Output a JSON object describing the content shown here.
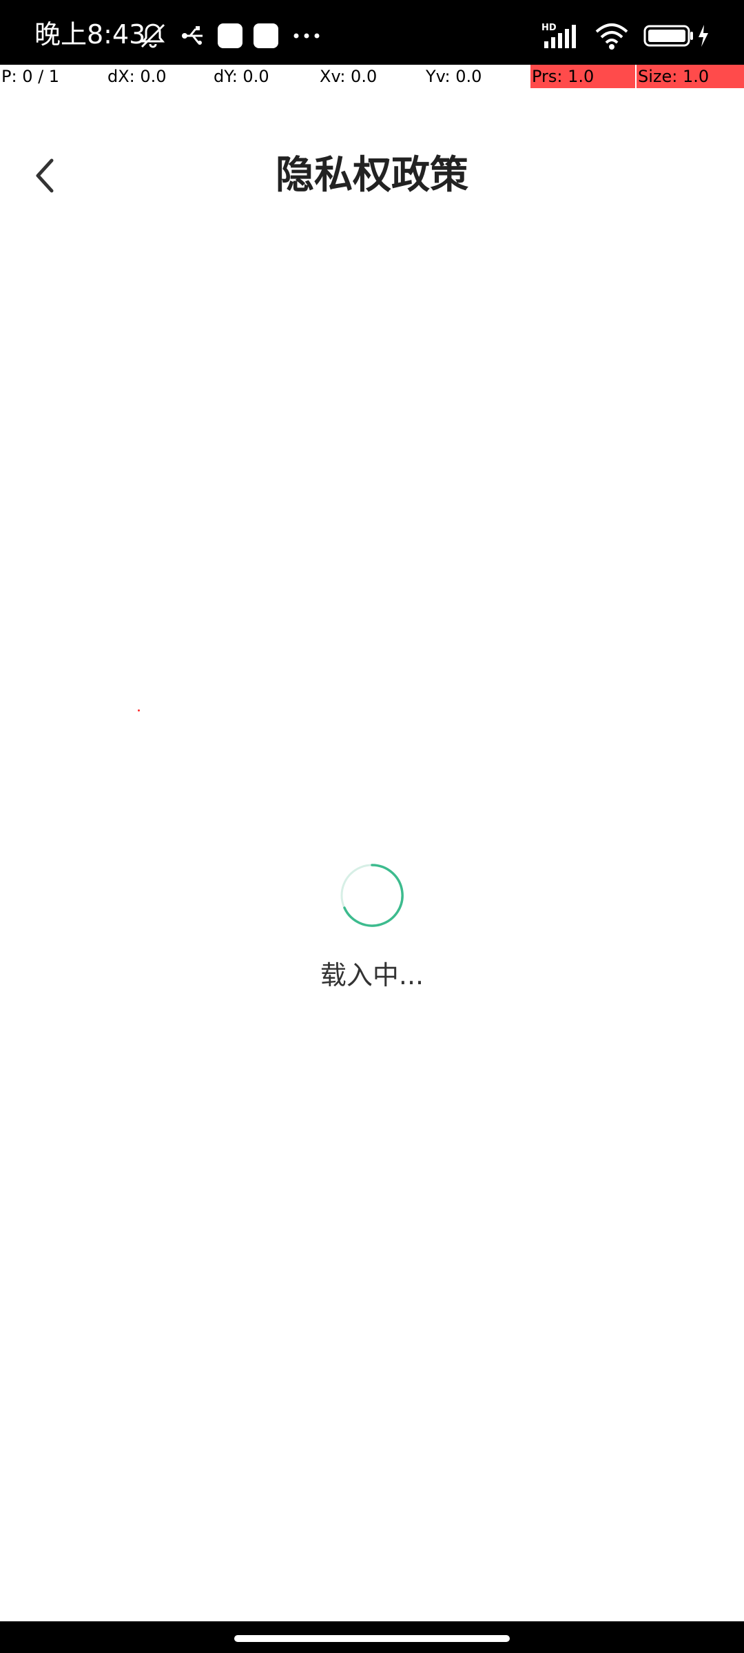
{
  "status_bar": {
    "time": "晚上8:43",
    "icons": [
      "bell-muted-icon",
      "usb-icon",
      "app-notification-icon",
      "app-notification-icon",
      "more-dots-icon",
      "hd-signal-icon",
      "wifi-icon",
      "battery-charging-icon"
    ]
  },
  "debug_overlay": {
    "pointer": "P: 0 / 1",
    "dx": "dX: 0.0",
    "dy": "dY: 0.0",
    "xv": "Xv: 0.0",
    "yv": "Yv: 0.0",
    "prs": "Prs: 1.0",
    "size": "Size: 1.0",
    "highlight_color": "#ff4b4b"
  },
  "header": {
    "title": "隐私权政策",
    "back_icon": "chevron-left-icon"
  },
  "loading": {
    "text": "载入中...",
    "spinner_color": "#3dbb8e"
  },
  "navigation": {
    "home_indicator": "home-indicator"
  }
}
